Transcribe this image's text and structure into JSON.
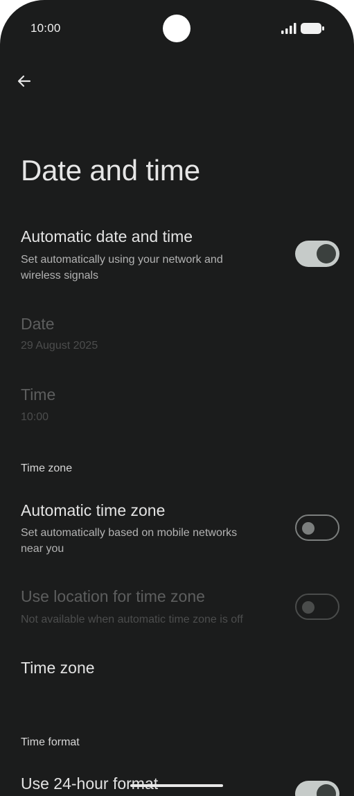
{
  "status_bar": {
    "time": "10:00",
    "icons": [
      "camera-cutout",
      "signal-icon",
      "battery-icon"
    ]
  },
  "header": {
    "back_icon": "arrow-left-icon",
    "title": "Date and time"
  },
  "items": {
    "automatic_date_time": {
      "title": "Automatic date and time",
      "subtitle_line1": "Set automatically using your network and",
      "subtitle_line2": "wireless signals",
      "toggle_on": true
    },
    "date": {
      "title": "Date",
      "value": "29 August 2025",
      "enabled": false
    },
    "time": {
      "title": "Time",
      "value": "10:00",
      "enabled": false
    },
    "automatic_time_zone": {
      "title": "Automatic time zone",
      "subtitle_line1": "Set automatically based on mobile networks",
      "subtitle_line2": "near you",
      "toggle_on": false
    },
    "use_location_time_zone": {
      "title": "Use location for time zone",
      "subtitle": "Not available when automatic time zone is off",
      "toggle_on": false,
      "enabled": false
    },
    "time_zone": {
      "title": "Time zone"
    },
    "use_24_hour": {
      "title": "Use 24-hour format",
      "toggle_on": true
    }
  },
  "sections": {
    "time_zone_header": "Time zone",
    "time_format_header": "Time format"
  },
  "colors": {
    "background": "#1b1c1c",
    "toggle_on_track": "#c6cbc9",
    "toggle_on_knob": "#3b403e",
    "toggle_off_outline": "#7c7f7e"
  }
}
